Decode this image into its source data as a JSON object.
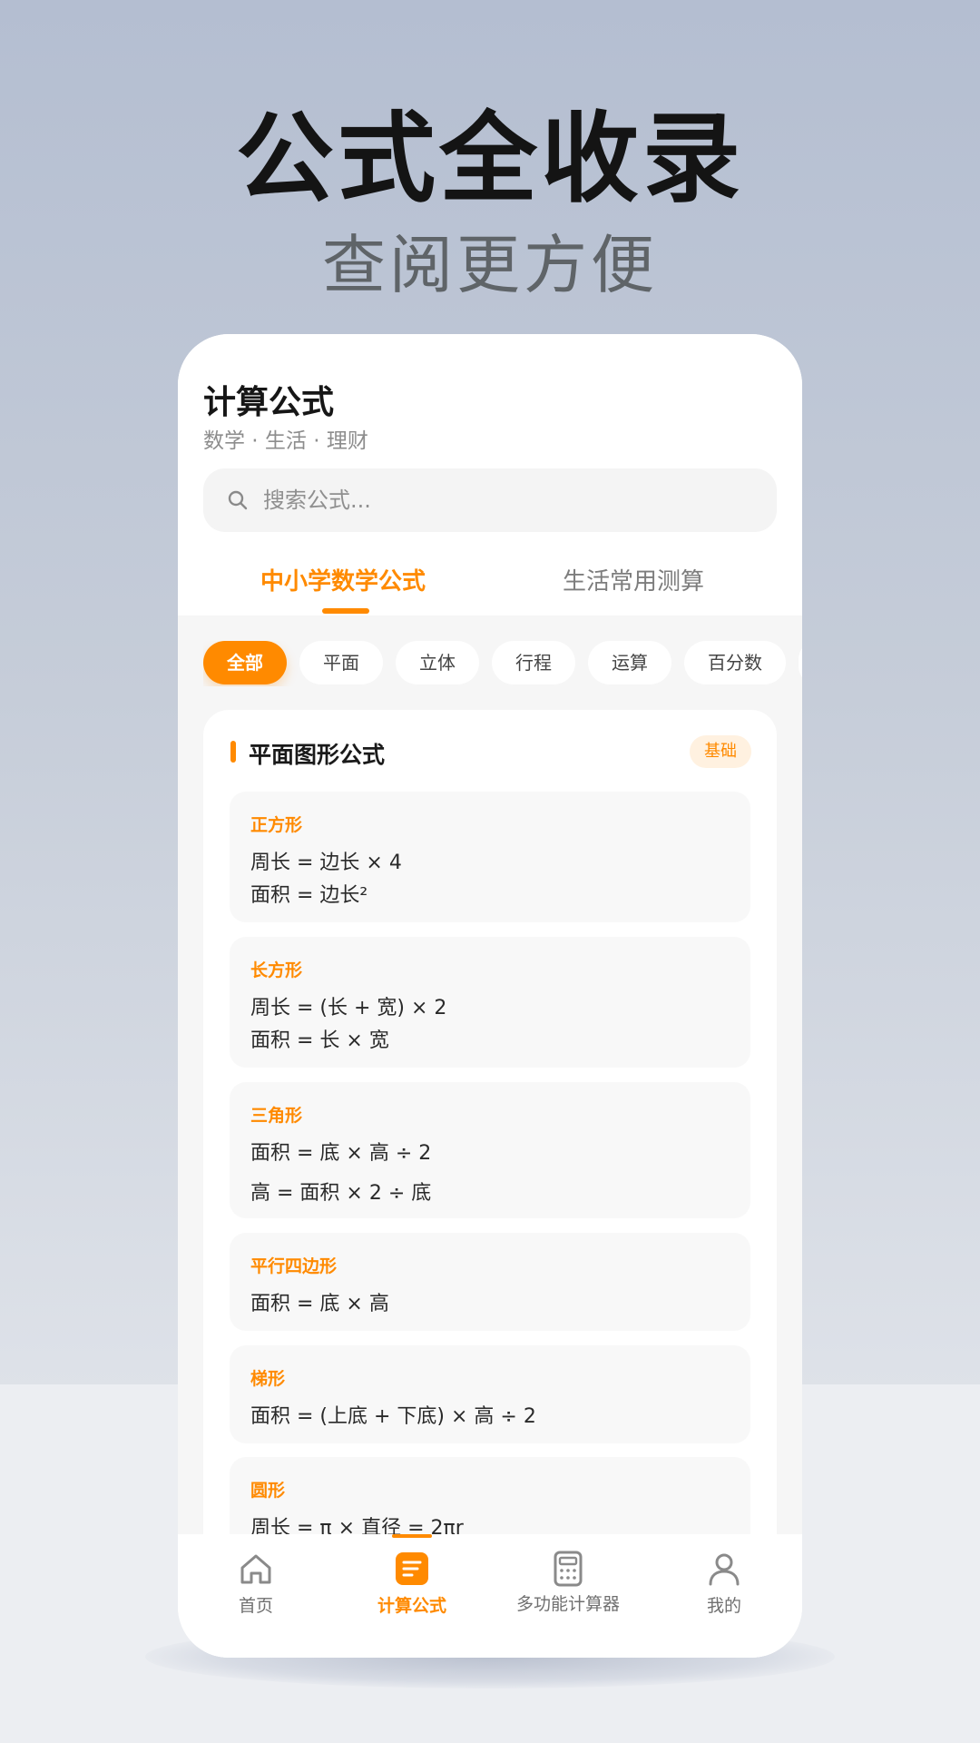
{
  "hero": {
    "title": "公式全收录",
    "subtitle": "查阅更方便"
  },
  "header": {
    "title": "计算公式",
    "subtitle": "数学 · 生活 · 理财"
  },
  "search": {
    "placeholder": "搜索公式..."
  },
  "tabs": [
    {
      "label": "中小学数学公式",
      "active": true
    },
    {
      "label": "生活常用测算",
      "active": false
    }
  ],
  "chips": [
    {
      "label": "全部",
      "active": true
    },
    {
      "label": "平面",
      "active": false
    },
    {
      "label": "立体",
      "active": false
    },
    {
      "label": "行程",
      "active": false
    },
    {
      "label": "运算",
      "active": false
    },
    {
      "label": "百分数",
      "active": false
    }
  ],
  "section": {
    "title": "平面图形公式",
    "badge": "基础"
  },
  "formulas": [
    {
      "name": "正方形",
      "lines": [
        "周长 = 边长 × 4",
        "面积 = 边长²"
      ]
    },
    {
      "name": "长方形",
      "lines": [
        "周长 = (长 + 宽) × 2",
        "面积 = 长 × 宽"
      ]
    },
    {
      "name": "三角形",
      "lines": [
        "面积 = 底 × 高 ÷ 2",
        "高 = 面积 × 2 ÷ 底"
      ]
    },
    {
      "name": "平行四边形",
      "lines": [
        "面积 = 底 × 高"
      ]
    },
    {
      "name": "梯形",
      "lines": [
        "面积 = (上底 + 下底) × 高 ÷ 2"
      ]
    },
    {
      "name": "圆形",
      "lines": [
        "周长 = π × 直径 = 2πr"
      ]
    }
  ],
  "nav": [
    {
      "label": "首页",
      "icon": "home-icon",
      "active": false
    },
    {
      "label": "计算公式",
      "icon": "formula-doc-icon",
      "active": true
    },
    {
      "label": "多功能计算器",
      "icon": "calculator-icon",
      "active": false
    },
    {
      "label": "我的",
      "icon": "user-icon",
      "active": false
    }
  ],
  "colors": {
    "accent": "#ff8a00",
    "text": "#1a1a1a",
    "muted": "#8d8d8d"
  }
}
